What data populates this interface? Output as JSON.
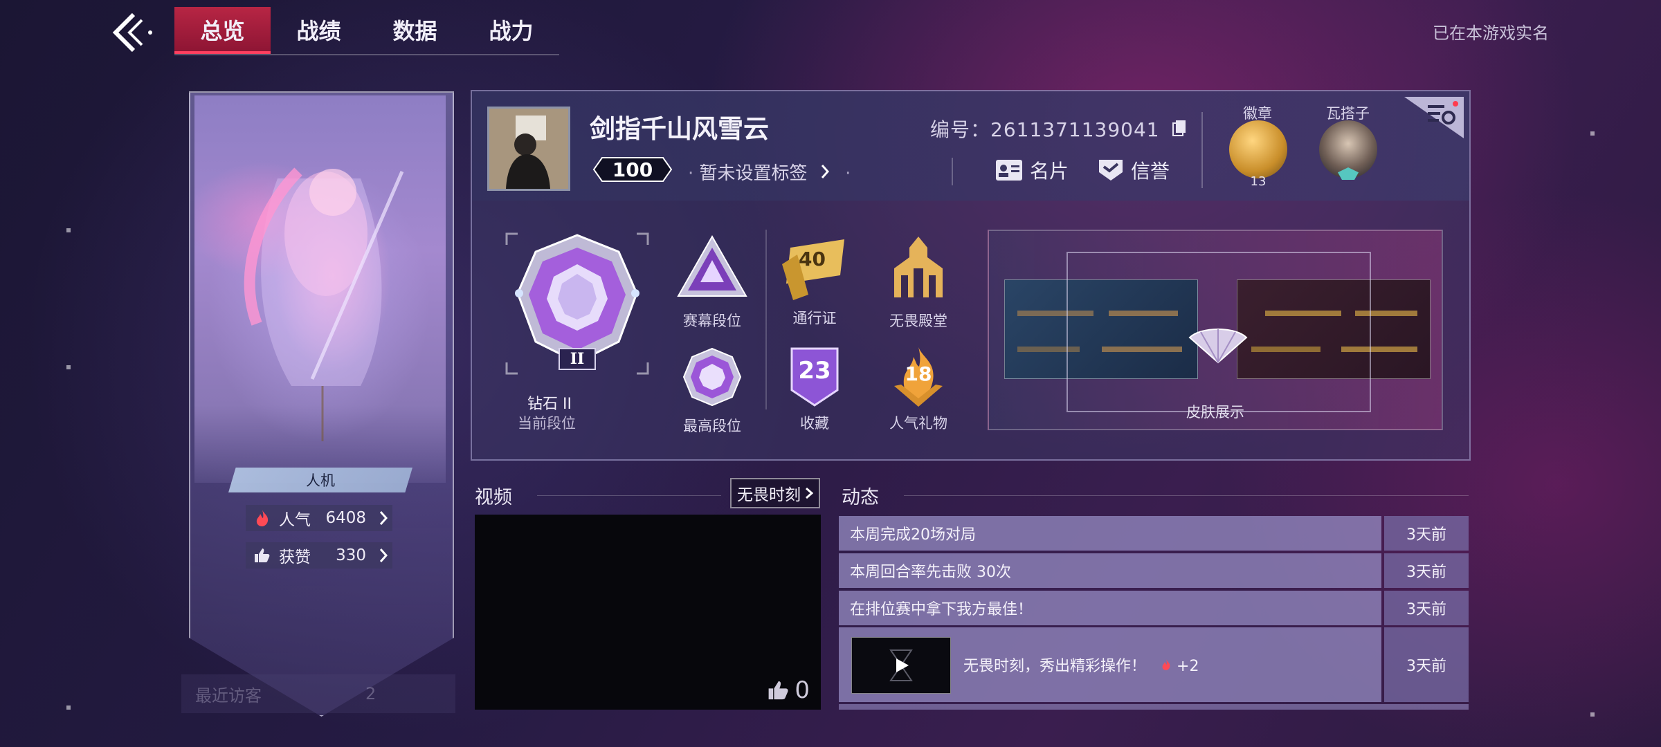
{
  "nav": {
    "tabs": [
      {
        "label": "总览",
        "active": true
      },
      {
        "label": "战绩",
        "active": false
      },
      {
        "label": "数据",
        "active": false
      },
      {
        "label": "战力",
        "active": false
      }
    ],
    "realname_status": "已在本游戏实名"
  },
  "left_card": {
    "mode_tag": "人机",
    "popularity_label": "人气",
    "popularity_value": "6408",
    "likes_label": "获赞",
    "likes_value": "330",
    "recent_visitors_label": "最近访客",
    "recent_visitors_count": "2"
  },
  "profile": {
    "username": "剑指千山风雪云",
    "level": "100",
    "tag_text": "暂未设置标签",
    "uid_label": "编号：",
    "uid_value": "2611371139041",
    "card_button": "名片",
    "credit_button": "信誉",
    "badge_label": "徽章",
    "badge_count": "13",
    "partner_label": "瓦搭子"
  },
  "rank": {
    "current_name": "钻石 II",
    "current_sub": "当前段位",
    "current_numeral": "II",
    "season_rank_label": "赛幕段位",
    "highest_rank_label": "最高段位"
  },
  "icons": {
    "pass_label": "通行证",
    "pass_value": "40",
    "hall_label": "无畏殿堂",
    "collection_label": "收藏",
    "collection_value": "23",
    "gifts_label": "人气礼物",
    "gifts_value": "18"
  },
  "skin_showcase": {
    "label": "皮肤展示"
  },
  "video": {
    "title": "视频",
    "link": "无畏时刻",
    "likes": "0"
  },
  "activity": {
    "title": "动态",
    "items": [
      {
        "text": "本周完成20场对局",
        "time": "3天前"
      },
      {
        "text": "本周回合率先击败 30次",
        "time": "3天前"
      },
      {
        "text": "在排位赛中拿下我方最佳！",
        "time": "3天前"
      }
    ],
    "feature": {
      "text": "无畏时刻，秀出精彩操作！",
      "bonus": "+2",
      "time": "3天前"
    }
  },
  "colors": {
    "accent_red": "#d8284a",
    "gold": "#e0a83a",
    "purple_gem": "#b57be6"
  }
}
